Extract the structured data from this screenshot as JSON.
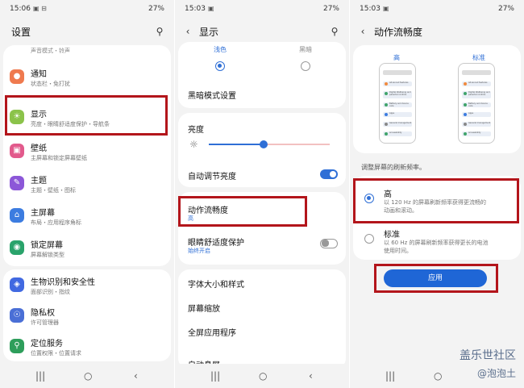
{
  "panel1": {
    "status": {
      "time": "15:06",
      "icons": "▣ ⊟",
      "right": "27%"
    },
    "title": "设置",
    "top_partial": "声音模式・铃声",
    "items": [
      {
        "title": "通知",
        "sub": "状态栏・免打扰",
        "icon": "bell-icon",
        "color": "#ef7a4f"
      },
      {
        "title": "显示",
        "sub": "亮度・眼睛舒适度保护・导航条",
        "icon": "sun-icon",
        "color": "#8bc34a"
      },
      {
        "title": "壁纸",
        "sub": "主屏幕和锁定屏幕壁纸",
        "icon": "image-icon",
        "color": "#e25a8c"
      },
      {
        "title": "主题",
        "sub": "主题・壁纸・图标",
        "icon": "brush-icon",
        "color": "#8c57d8"
      },
      {
        "title": "主屏幕",
        "sub": "布局・应用程序角标",
        "icon": "home-icon",
        "color": "#3c7ce0"
      },
      {
        "title": "锁定屏幕",
        "sub": "屏幕解锁类型",
        "icon": "lock-icon",
        "color": "#2aa36b"
      },
      {
        "title": "生物识别和安全性",
        "sub": "面部识别・指纹",
        "icon": "shield-icon",
        "color": "#4169e1"
      },
      {
        "title": "隐私权",
        "sub": "许可管理器",
        "icon": "privacy-icon",
        "color": "#4a6fd6"
      },
      {
        "title": "定位服务",
        "sub": "位置权限・位置请求",
        "icon": "location-icon",
        "color": "#2e9e5b"
      }
    ]
  },
  "panel2": {
    "status": {
      "time": "15:03",
      "icons": "▣",
      "right": "27%"
    },
    "title": "显示",
    "mode_light": "浅色",
    "mode_dark": "黑暗",
    "dark_settings": "黑暗模式设置",
    "brightness": "亮度",
    "brightness_value": 0.45,
    "auto_brightness": "自动调节亮度",
    "motion": "动作流畅度",
    "motion_value": "高",
    "eye": "眼睛舒适度保护",
    "eye_value": "始终开启",
    "font": "字体大小和样式",
    "zoom": "屏幕缩放",
    "fullscreen": "全屏应用程序",
    "partial": "自动息屏"
  },
  "panel3": {
    "status": {
      "time": "15:03",
      "icons": "▣",
      "right": "27%"
    },
    "title": "动作流畅度",
    "high_label": "高",
    "std_label": "标准",
    "preview_items": [
      "Advanced features",
      "Digital Wellbeing and parental controls",
      "Battery and device care",
      "Apps",
      "General management",
      "Accessibility"
    ],
    "desc": "调整屏幕的刷新频率。",
    "opt_high_title": "高",
    "opt_high_desc": "以 120 Hz 的屏幕刷新频率获得更流畅的动画和滚动。",
    "opt_std_title": "标准",
    "opt_std_desc": "以 60 Hz 的屏幕刷新频率获得更长的电池使用时间。",
    "apply": "应用",
    "watermark1": "盖乐世社区",
    "watermark2": "@泡泡土"
  },
  "colors": {
    "accent": "#2f6fd6",
    "highlight": "#b3151b",
    "apply": "#1f66d6"
  },
  "nav": {
    "recent": "|||",
    "home": "○",
    "back": "‹"
  }
}
